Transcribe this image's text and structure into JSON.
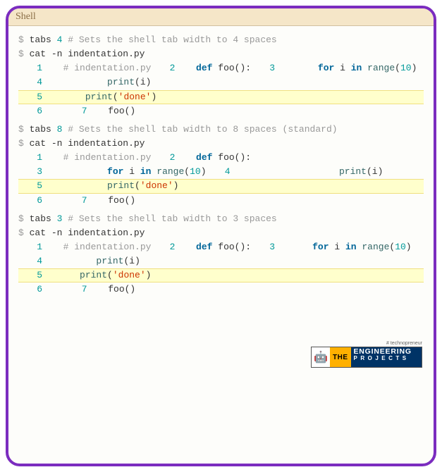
{
  "header": {
    "title": "Shell"
  },
  "prompt": "$",
  "blocks": [
    {
      "tabs_cmd": "tabs",
      "tabs_n": "4",
      "tabs_comment": "# Sets the shell tab width to 4 spaces",
      "cat_cmd": "cat -n",
      "cat_file": "indentation.py",
      "indent_unit": "    ",
      "lines": [
        {
          "n": "1",
          "content": "# indentation.py",
          "type": "comment",
          "hl": false
        },
        {
          "n": "2",
          "content": "def foo():",
          "type": "def",
          "hl": false
        },
        {
          "n": "3",
          "content": "for i in range(10)",
          "type": "for",
          "indent": 1,
          "hl": false
        },
        {
          "n": "4",
          "content": "print(i)",
          "type": "call",
          "indent": 2,
          "hl": false
        },
        {
          "n": "5",
          "content": "print('done')",
          "type": "callstr",
          "indent": 1,
          "hl": true
        },
        {
          "n": "6",
          "content": "",
          "type": "blank",
          "hl": false
        },
        {
          "n": "7",
          "content": "foo()",
          "type": "plaincall",
          "hl": false
        }
      ]
    },
    {
      "tabs_cmd": "tabs",
      "tabs_n": "8",
      "tabs_comment": "# Sets the shell tab width to 8 spaces (standard)",
      "cat_cmd": "cat -n",
      "cat_file": "indentation.py",
      "indent_unit": "        ",
      "lines": [
        {
          "n": "1",
          "content": "# indentation.py",
          "type": "comment",
          "hl": false
        },
        {
          "n": "2",
          "content": "def foo():",
          "type": "def",
          "hl": false
        },
        {
          "n": "3",
          "content": "for i in range(10)",
          "type": "for",
          "indent": 1,
          "hl": false
        },
        {
          "n": "4",
          "content": "print(i)",
          "type": "call",
          "indent": 2,
          "hl": false
        },
        {
          "n": "5",
          "content": "print('done')",
          "type": "callstr",
          "indent": 1,
          "hl": true
        },
        {
          "n": "6",
          "content": "",
          "type": "blank",
          "hl": false
        },
        {
          "n": "7",
          "content": "foo()",
          "type": "plaincall",
          "hl": false
        }
      ]
    },
    {
      "tabs_cmd": "tabs",
      "tabs_n": "3",
      "tabs_comment": "# Sets the shell tab width to 3 spaces",
      "cat_cmd": "cat -n",
      "cat_file": "indentation.py",
      "indent_unit": "   ",
      "lines": [
        {
          "n": "1",
          "content": "# indentation.py",
          "type": "comment",
          "hl": false
        },
        {
          "n": "2",
          "content": "def foo():",
          "type": "def",
          "hl": false
        },
        {
          "n": "3",
          "content": "for i in range(10)",
          "type": "for",
          "indent": 1,
          "hl": false
        },
        {
          "n": "4",
          "content": "print(i)",
          "type": "call",
          "indent": 2,
          "hl": false
        },
        {
          "n": "5",
          "content": "print('done')",
          "type": "callstr",
          "indent": 1,
          "hl": true
        },
        {
          "n": "6",
          "content": "",
          "type": "blank",
          "hl": false
        },
        {
          "n": "7",
          "content": "foo()",
          "type": "plaincall",
          "hl": false
        }
      ]
    }
  ],
  "watermark": {
    "tag": "# technopreneur",
    "the": "THE",
    "line1": "ENGINEERING",
    "line2": "PROJECTS",
    "robot": "🤖"
  }
}
